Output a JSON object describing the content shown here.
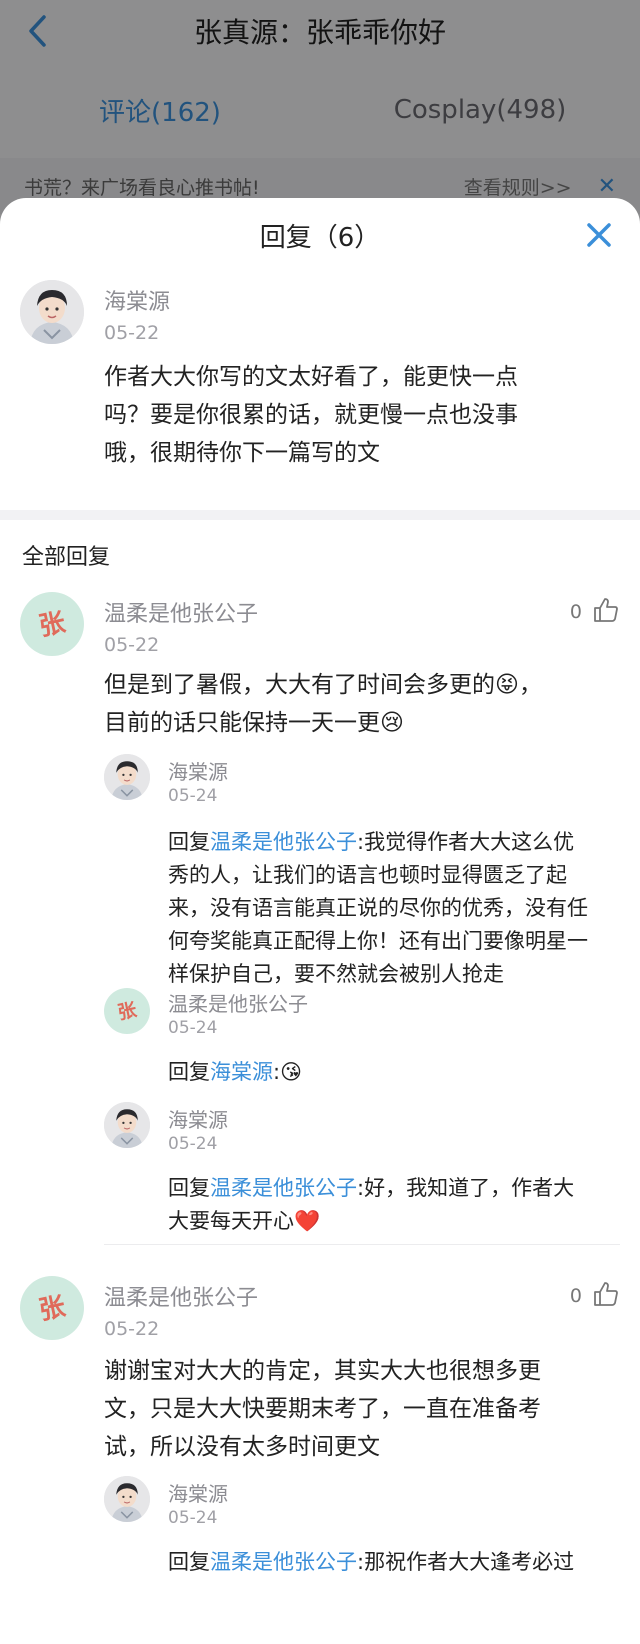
{
  "header": {
    "back_icon": "chevron-left-icon",
    "title": "张真源：张乖乖你好",
    "tabs": [
      {
        "label": "评论(162)",
        "active": true
      },
      {
        "label": "Cosplay(498)",
        "active": false
      }
    ],
    "notice": {
      "message": "书荒？来广场看良心推书帖!",
      "rules": "查看规则>>",
      "close_icon": "close-icon"
    }
  },
  "sheet": {
    "title": "回复（6）",
    "close_icon": "close-icon",
    "main_comment": {
      "user": "海棠源",
      "date": "05-22",
      "lines": [
        "作者大大你写的文太好看了，能更快一点",
        "吗？要是你很累的话，就更慢一点也没事",
        "哦，很期待你下一篇写的文"
      ]
    },
    "section_title": "全部回复",
    "threads": [
      {
        "user": "温柔是他张公子",
        "date": "05-22",
        "likes": "0",
        "lines": [
          "但是到了暑假，大大有了时间会多更的😝，",
          "目前的话只能保持一天一更😢"
        ],
        "replies": [
          {
            "user": "海棠源",
            "date": "05-24",
            "prefix": "回复",
            "target": "温柔是他张公子",
            "lines": [
              "我觉得作者大大这么优",
              "秀的人，让我们的语言也顿时显得匮乏了起",
              "来，没有语言能真正说的尽你的优秀，没有任",
              "何夸奖能真正配得上你！还有出门要像明星一",
              "样保护自己，要不然就会被别人抢走"
            ]
          },
          {
            "user": "温柔是他张公子",
            "date": "05-24",
            "prefix": "回复",
            "target": "海棠源",
            "lines": [
              "😘"
            ]
          },
          {
            "user": "海棠源",
            "date": "05-24",
            "prefix": "回复",
            "target": "温柔是他张公子",
            "lines": [
              "好，我知道了，作者大",
              "大要每天开心❤️"
            ]
          }
        ]
      },
      {
        "user": "温柔是他张公子",
        "date": "05-22",
        "likes": "0",
        "lines": [
          "谢谢宝对大大的肯定，其实大大也很想多更",
          "文，只是大大快要期末考了，一直在准备考",
          "试，所以没有太多时间更文"
        ],
        "replies": [
          {
            "user": "海棠源",
            "date": "05-24",
            "prefix": "回复",
            "target": "温柔是他张公子",
            "lines": [
              "那祝作者大大逢考必过"
            ]
          }
        ]
      }
    ],
    "colors": {
      "accent": "#3b8fd9",
      "zhang_avatar_bg": "#cfeadf",
      "zhang_avatar_text": "#e06a5a"
    },
    "zhang_avatar_char": "张"
  }
}
